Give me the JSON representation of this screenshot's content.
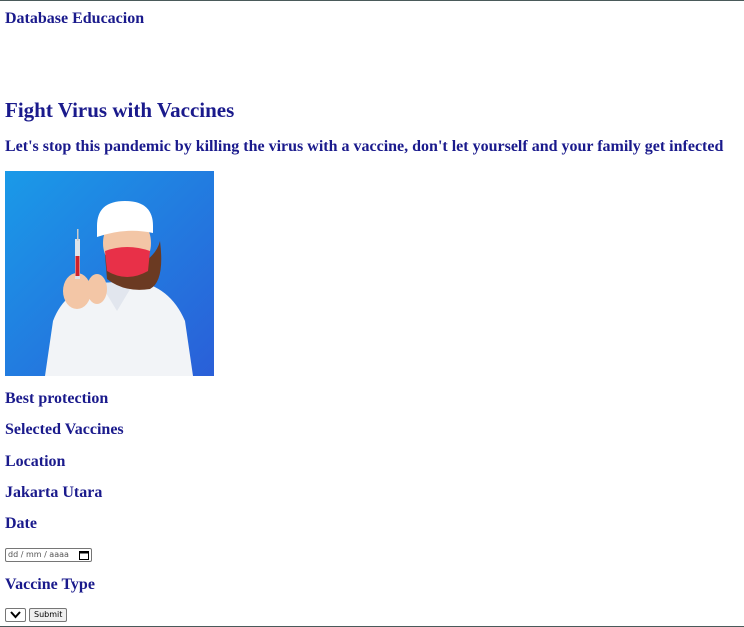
{
  "brand": "Database Educacion",
  "hero": {
    "title": "Fight Virus with Vaccines",
    "subtitle": "Let's stop this pandemic by killing the virus with a vaccine, don't let yourself and your family get infected"
  },
  "labels": {
    "best_protection": "Best protection",
    "selected_vaccines": "Selected Vaccines",
    "location": "Location",
    "location_value": "Jakarta Utara",
    "date": "Date",
    "vaccine_type": "Vaccine Type"
  },
  "form": {
    "date_placeholder": "dd / mm / aaaa",
    "submit_label": "Submit"
  },
  "colors": {
    "text": "#1a1a8c",
    "image_bg": "#2a7fe0"
  }
}
